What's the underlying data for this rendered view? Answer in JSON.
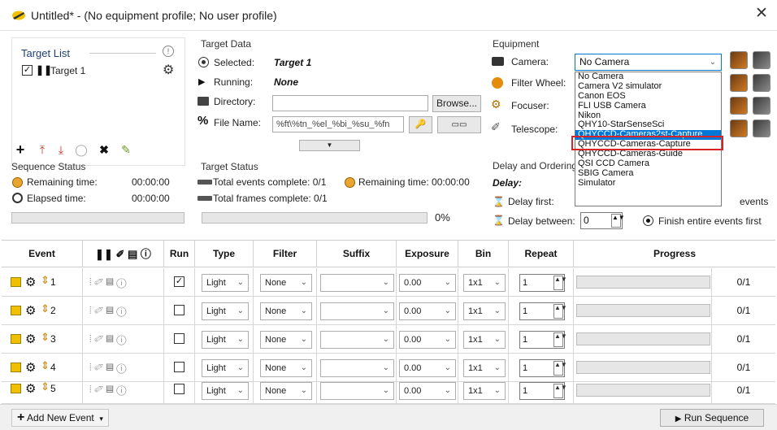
{
  "window": {
    "title": "Untitled* - (No equipment profile; No user profile)"
  },
  "target_list": {
    "title": "Target List",
    "items": [
      {
        "label": "Target 1",
        "checked": true
      }
    ]
  },
  "target_data": {
    "title": "Target Data",
    "selected_label": "Selected:",
    "selected_value": "Target 1",
    "running_label": "Running:",
    "running_value": "None",
    "directory_label": "Directory:",
    "directory_value": "",
    "browse_label": "Browse...",
    "filename_label": "File Name:",
    "filename_value": "%ft\\%tn_%el_%bi_%su_%fn"
  },
  "equipment": {
    "title": "Equipment",
    "camera_label": "Camera:",
    "camera_value": "No Camera",
    "filterwheel_label": "Filter Wheel:",
    "focuser_label": "Focuser:",
    "telescope_label": "Telescope:",
    "camera_options": [
      "No Camera",
      "Camera V2 simulator",
      "Canon EOS",
      "FLI USB Camera",
      "Nikon",
      "QHY10-StarSenseSci",
      "QHYCCD-Cameras2st-Capture",
      "QHYCCD-Cameras-Capture",
      "QHYCCD-Cameras-Guide",
      "QSI CCD Camera",
      "SBIG Camera",
      "Simulator"
    ],
    "highlighted_option": "QHYCCD-Cameras2st-Capture"
  },
  "sequence_status": {
    "title": "Sequence Status",
    "remaining_label": "Remaining time:",
    "remaining_value": "00:00:00",
    "elapsed_label": "Elapsed time:",
    "elapsed_value": "00:00:00"
  },
  "target_status": {
    "title": "Target Status",
    "events_label": "Total events complete: 0/1",
    "remaining_label": "Remaining time: 00:00:00",
    "frames_label": "Total frames complete: 0/1",
    "percent": "0%"
  },
  "delay": {
    "title": "Delay and Ordering",
    "delay_label": "Delay:",
    "delay_first_label": "Delay first:",
    "delay_between_label": "Delay between:",
    "delay_between_value": "0",
    "events_partial": "events",
    "finish_label": "Finish entire events first"
  },
  "grid": {
    "headers": {
      "event": "Event",
      "run": "Run",
      "type": "Type",
      "filter": "Filter",
      "suffix": "Suffix",
      "exposure": "Exposure",
      "bin": "Bin",
      "repeat": "Repeat",
      "progress": "Progress"
    },
    "rows": [
      {
        "num": "1",
        "run": true,
        "type": "Light",
        "filter": "None",
        "suffix": "",
        "exposure": "0.00",
        "bin": "1x1",
        "repeat": "1",
        "progress": "0/1"
      },
      {
        "num": "2",
        "run": false,
        "type": "Light",
        "filter": "None",
        "suffix": "",
        "exposure": "0.00",
        "bin": "1x1",
        "repeat": "1",
        "progress": "0/1"
      },
      {
        "num": "3",
        "run": false,
        "type": "Light",
        "filter": "None",
        "suffix": "",
        "exposure": "0.00",
        "bin": "1x1",
        "repeat": "1",
        "progress": "0/1"
      },
      {
        "num": "4",
        "run": false,
        "type": "Light",
        "filter": "None",
        "suffix": "",
        "exposure": "0.00",
        "bin": "1x1",
        "repeat": "1",
        "progress": "0/1"
      },
      {
        "num": "5",
        "run": false,
        "type": "Light",
        "filter": "None",
        "suffix": "",
        "exposure": "0.00",
        "bin": "1x1",
        "repeat": "1",
        "progress": "0/1"
      }
    ]
  },
  "bottom": {
    "add_event_label": "Add New Event",
    "run_sequence_label": "Run Sequence"
  },
  "colors": {
    "accent": "#0078d7",
    "group_title": "#1e3f78",
    "highlight_box": "#d8232a"
  }
}
